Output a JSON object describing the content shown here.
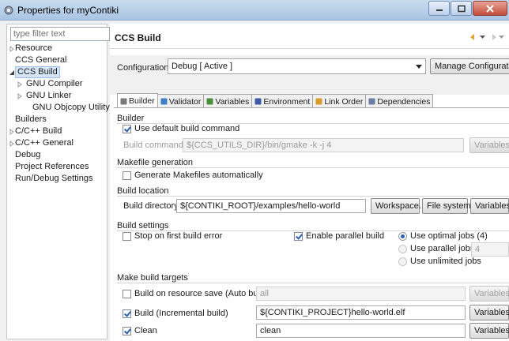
{
  "window": {
    "title": "Properties for myContiki"
  },
  "left_pane": {
    "filter_placeholder": "type filter text",
    "tree": [
      {
        "label": "Resource",
        "level": 0,
        "twisty": "collapsed"
      },
      {
        "label": "CCS General",
        "level": 0,
        "twisty": "none"
      },
      {
        "label": "CCS Build",
        "level": 0,
        "twisty": "expanded",
        "selected": true
      },
      {
        "label": "GNU Compiler",
        "level": 1,
        "twisty": "collapsed"
      },
      {
        "label": "GNU Linker",
        "level": 1,
        "twisty": "collapsed"
      },
      {
        "label": "GNU Objcopy Utility |",
        "level": 1,
        "twisty": "none"
      },
      {
        "label": "Builders",
        "level": 0,
        "twisty": "none"
      },
      {
        "label": "C/C++ Build",
        "level": 0,
        "twisty": "collapsed"
      },
      {
        "label": "C/C++ General",
        "level": 0,
        "twisty": "collapsed"
      },
      {
        "label": "Debug",
        "level": 0,
        "twisty": "none"
      },
      {
        "label": "Project References",
        "level": 0,
        "twisty": "none"
      },
      {
        "label": "Run/Debug Settings",
        "level": 0,
        "twisty": "none"
      }
    ]
  },
  "page": {
    "title": "CCS Build",
    "configuration_label": "Configuration:",
    "configuration_value": "Debug  [ Active ]",
    "manage_button": "Manage Configurations"
  },
  "tabs": [
    {
      "label": "Builder",
      "icon": "builder-icon",
      "active": true
    },
    {
      "label": "Validator",
      "icon": "validator-icon"
    },
    {
      "label": "Variables",
      "icon": "variables-icon"
    },
    {
      "label": "Environment",
      "icon": "environment-icon"
    },
    {
      "label": "Link Order",
      "icon": "link-order-icon"
    },
    {
      "label": "Dependencies",
      "icon": "dependencies-icon"
    }
  ],
  "builder": {
    "builder_section": "Builder",
    "use_default_label": "Use default build command",
    "use_default_checked": true,
    "build_command_label": "Build command:",
    "build_command_value": "${CCS_UTILS_DIR}/bin/gmake -k -j 4",
    "variables_button": "Variables...",
    "makefile_section": "Makefile generation",
    "generate_makefiles_label": "Generate Makefiles automatically",
    "generate_makefiles_checked": false,
    "location_section": "Build location",
    "build_directory_label": "Build directory:",
    "build_directory_value": "${CONTIKI_ROOT}/examples/hello-world",
    "workspace_button": "Workspace...",
    "filesystem_button": "File system...",
    "settings_section": "Build settings",
    "stop_on_error_label": "Stop on first build error",
    "stop_on_error_checked": false,
    "parallel_build_label": "Enable parallel build",
    "parallel_build_checked": true,
    "optimal_jobs_label": "Use optimal jobs (4)",
    "parallel_jobs_label": "Use parallel jobs:",
    "parallel_jobs_value": "4",
    "unlimited_jobs_label": "Use unlimited jobs",
    "targets_section": "Make build targets",
    "auto_build_label": "Build on resource save (Auto build)",
    "auto_build_checked": false,
    "auto_build_value": "all",
    "incremental_label": "Build (Incremental build)",
    "incremental_checked": true,
    "incremental_value": "${CONTIKI_PROJECT}hello-world.elf",
    "clean_label": "Clean",
    "clean_checked": true,
    "clean_value": "clean"
  },
  "colors": {
    "accent": "#2a5fb0",
    "selection": "#d5e5f7",
    "titlebar": "#a9c4e2",
    "close": "#c24e3a"
  }
}
